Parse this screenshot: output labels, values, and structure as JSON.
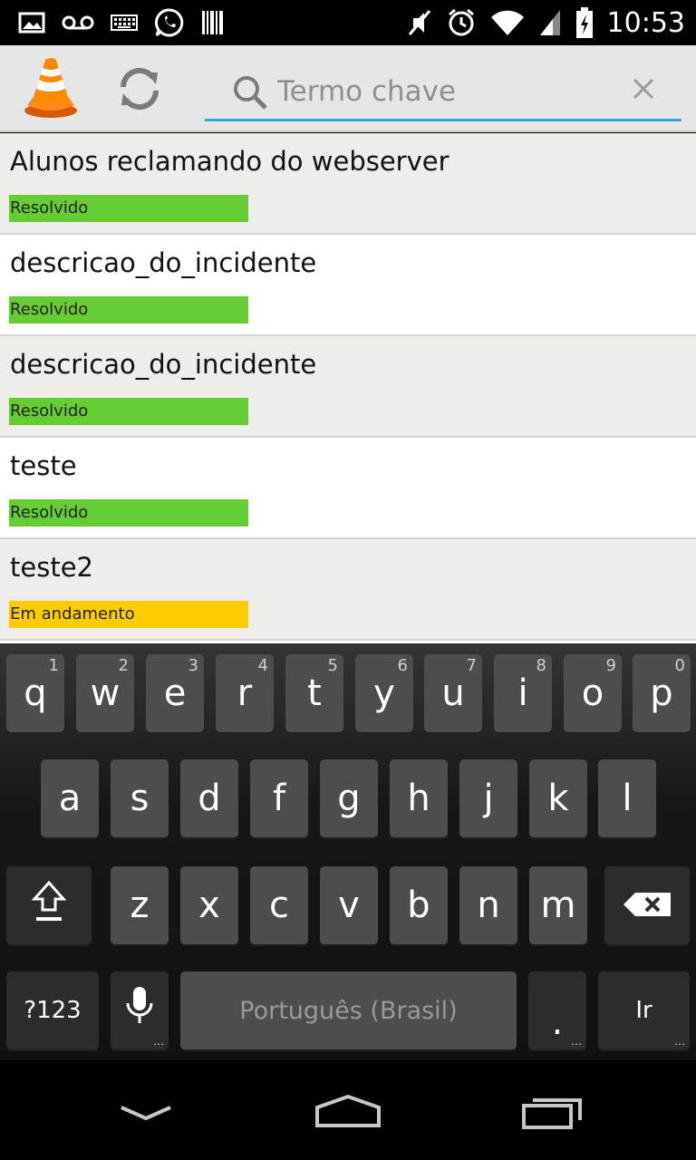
{
  "status_bar": {
    "time": "10:53",
    "left_icons": [
      "image-icon",
      "voicemail-icon",
      "keyboard-icon",
      "whatsapp-icon",
      "barcode-icon"
    ],
    "right_icons": [
      "mute-icon",
      "alarm-icon",
      "wifi-icon",
      "signal-icon",
      "battery-icon"
    ]
  },
  "action_bar": {
    "search": {
      "placeholder": "Termo chave",
      "value": ""
    }
  },
  "incidents": [
    {
      "title": "Alunos reclamando do webserver",
      "status": "Resolvido",
      "status_color": "#66cc33"
    },
    {
      "title": "descricao_do_incidente",
      "status": "Resolvido",
      "status_color": "#66cc33"
    },
    {
      "title": "descricao_do_incidente",
      "status": "Resolvido",
      "status_color": "#66cc33"
    },
    {
      "title": "teste",
      "status": "Resolvido",
      "status_color": "#66cc33"
    },
    {
      "title": "teste2",
      "status": "Em andamento",
      "status_color": "#ffcc00"
    }
  ],
  "keyboard": {
    "row1": [
      {
        "k": "q",
        "n": "1"
      },
      {
        "k": "w",
        "n": "2"
      },
      {
        "k": "e",
        "n": "3"
      },
      {
        "k": "r",
        "n": "4"
      },
      {
        "k": "t",
        "n": "5"
      },
      {
        "k": "y",
        "n": "6"
      },
      {
        "k": "u",
        "n": "7"
      },
      {
        "k": "i",
        "n": "8"
      },
      {
        "k": "o",
        "n": "9"
      },
      {
        "k": "p",
        "n": "0"
      }
    ],
    "row2": [
      "a",
      "s",
      "d",
      "f",
      "g",
      "h",
      "j",
      "k",
      "l"
    ],
    "row3": [
      "z",
      "x",
      "c",
      "v",
      "b",
      "n",
      "m"
    ],
    "symbols_label": "?123",
    "space_label": "Português (Brasil)",
    "period_label": ".",
    "go_label": "Ir"
  },
  "colors": {
    "accent": "#33a6d6",
    "resolved": "#66cc33",
    "in_progress": "#ffcc00"
  }
}
